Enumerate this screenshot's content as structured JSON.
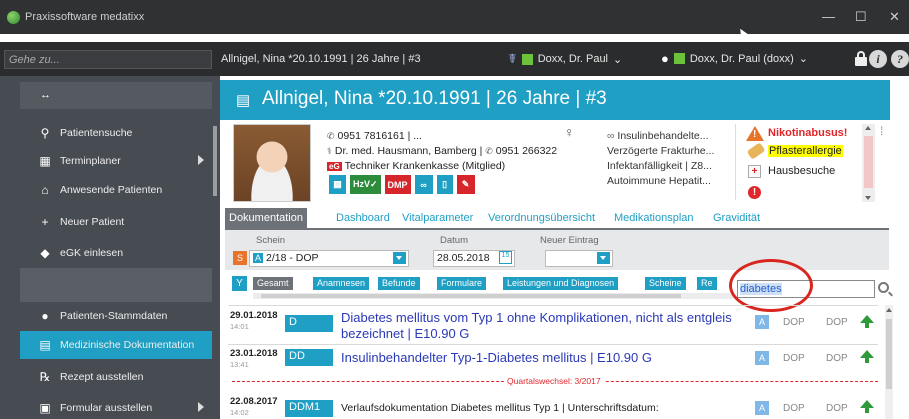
{
  "window": {
    "title": "Praxissoftware medatixx",
    "controls": {
      "minimize": "—",
      "maximize": "☐",
      "close": "✕"
    }
  },
  "command_bar": {
    "goto_placeholder": "Gehe zu...",
    "patient": "Allnigel, Nina *20.10.1991 | 26 Jahre | #3",
    "doctor": "Doxx, Dr. Paul",
    "user": "Doxx, Dr. Paul (doxx)",
    "info_icon_glyph": "i",
    "help_icon_glyph": "?",
    "status_color": "#6cc23a"
  },
  "sidebar": {
    "collapse_glyph": "↔",
    "items": [
      {
        "label": "Patientensuche",
        "icon": "patient-search-icon",
        "glyph": "⚲",
        "arrow": false,
        "active": false
      },
      {
        "label": "Terminplaner",
        "icon": "calendar-icon",
        "glyph": "▦",
        "arrow": true,
        "active": false
      },
      {
        "label": "Anwesende Patienten",
        "icon": "waiting-room-icon",
        "glyph": "⌂",
        "arrow": false,
        "active": false
      },
      {
        "label": "Neuer Patient",
        "icon": "new-patient-icon",
        "glyph": "+",
        "arrow": false,
        "active": false
      },
      {
        "label": "eGK einlesen",
        "icon": "card-reader-icon",
        "glyph": "◆",
        "arrow": false,
        "active": false
      },
      {
        "label": "Patienten-Stammdaten",
        "icon": "patient-data-icon",
        "glyph": "●",
        "arrow": false,
        "active": false
      },
      {
        "label": "Medizinische Dokumentation",
        "icon": "medical-doc-icon",
        "glyph": "▤",
        "arrow": false,
        "active": true
      },
      {
        "label": "Rezept ausstellen",
        "icon": "prescription-icon",
        "glyph": "℞",
        "arrow": false,
        "active": false
      },
      {
        "label": "Formular ausstellen",
        "icon": "form-icon",
        "glyph": "▣",
        "arrow": true,
        "active": false
      }
    ]
  },
  "patient": {
    "header": "Allnigel, Nina *20.10.1991 | 26 Jahre | #3",
    "phone": "0951 7816161 | ...",
    "doctor": "Dr. med. Hausmann, Bamberg | ",
    "doctor_phone": "0951 266322",
    "insurance_badge": "eG",
    "insurance": "Techniker Krankenkasse (Mitglied)",
    "badges": {
      "hzv": "HzV✓",
      "dmp": "DMP",
      "inf": "∞"
    },
    "gender_glyph": "♀",
    "diagnoses": [
      "Insulinbehandelte...",
      "Verzögerte Frakturhe...",
      "Infektanfälligkeit | Z8...",
      "Autoimmune Hepatit..."
    ],
    "inf_glyph": "∞",
    "alerts": {
      "warn_glyph": "!",
      "smoking": "Nikotinabusus!",
      "allergy": "Pflasterallergie",
      "house_call": "Hausbesuche",
      "house_glyph": "+",
      "excl_glyph": "!"
    },
    "alert_color": "#e0262b",
    "pin_glyph": "⁞"
  },
  "tabs": [
    {
      "label": "Dokumentation",
      "active": true
    },
    {
      "label": "Dashboard",
      "active": false
    },
    {
      "label": "Vitalparameter",
      "active": false
    },
    {
      "label": "Verordnungsübersicht",
      "active": false
    },
    {
      "label": "Medikationsplan",
      "active": false
    },
    {
      "label": "Gravidität",
      "active": false
    }
  ],
  "schein": {
    "schein_label": "Schein",
    "schein_icon": "S",
    "schein_badge": "A",
    "schein_value": "2/18 - DOP",
    "datum_label": "Datum",
    "datum_value": "28.05.2018",
    "cal_label": "15",
    "neuer_label": "Neuer Eintrag"
  },
  "filters": {
    "funnel_glyph": "Y",
    "buttons": [
      "Gesamt",
      "Anamnesen",
      "Befunde",
      "Formulare",
      "Leistungen und Diagnosen",
      "Scheine",
      "Re"
    ],
    "search_value": "diabetes"
  },
  "entries": [
    {
      "date": "29.01.2018",
      "time": "14:01",
      "type": "D",
      "text_line1": "Diabetes mellitus vom Typ 1 ohne Komplikationen, nicht als entgleis",
      "text_line2": "bezeichnet |  E10.90 G",
      "a": "A",
      "dop1": "DOP",
      "dop2": "DOP"
    },
    {
      "date": "23.01.2018",
      "time": "13:41",
      "type": "DD",
      "text_line1": "Insulinbehandelter Typ-1-Diabetes mellitus  |  E10.90 G",
      "a": "A",
      "dop1": "DOP",
      "dop2": "DOP"
    },
    {
      "date": "22.08.2017",
      "time": "14:02",
      "type": "DDM1",
      "text_line1": "Verlaufsdokumentation Diabetes mellitus Typ 1 | Unterschriftsdatum:",
      "a": "A",
      "dop1": "DOP",
      "dop2": "DOP"
    }
  ],
  "quartal_separator": "Quartalswechsel: 3/2017"
}
